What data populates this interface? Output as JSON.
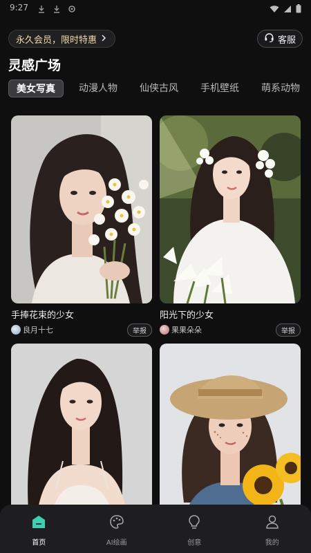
{
  "status": {
    "time": "9:27"
  },
  "header": {
    "vip_label": "永久会员，限时特惠",
    "service_label": "客服",
    "title": "灵感广场"
  },
  "tabs": [
    {
      "label": "美女写真",
      "active": true
    },
    {
      "label": "动漫人物",
      "active": false
    },
    {
      "label": "仙侠古风",
      "active": false
    },
    {
      "label": "手机壁纸",
      "active": false
    },
    {
      "label": "萌系动物",
      "active": false
    }
  ],
  "cards": [
    {
      "title": "手捧花束的少女",
      "author": "良月十七",
      "report_label": "举报"
    },
    {
      "title": "阳光下的少女",
      "author": "果果朵朵",
      "report_label": "举报"
    },
    {
      "title": "",
      "author": "",
      "report_label": ""
    },
    {
      "title": "",
      "author": "",
      "report_label": ""
    }
  ],
  "nav": [
    {
      "label": "首页",
      "icon": "home-icon",
      "active": true
    },
    {
      "label": "AI绘画",
      "icon": "palette-icon",
      "active": false
    },
    {
      "label": "创意",
      "icon": "lightbulb-icon",
      "active": false
    },
    {
      "label": "我的",
      "icon": "user-icon",
      "active": false
    }
  ],
  "colors": {
    "accent": "#3ecfb0",
    "background": "#0f0f10",
    "vip_text": "#f0d9a8"
  }
}
